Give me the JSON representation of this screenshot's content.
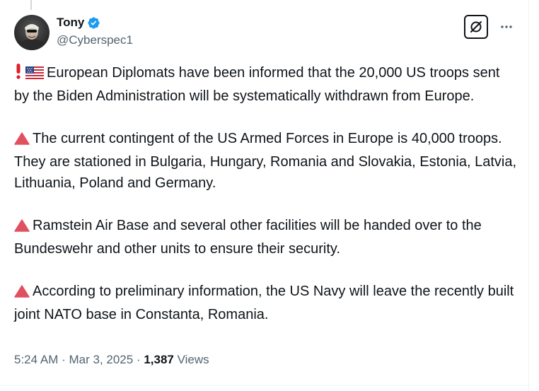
{
  "author": {
    "display_name": "Tony",
    "handle": "@Cyberspec1",
    "verified": true,
    "avatar_icon": "avatar-person-icon"
  },
  "actions": {
    "grok_icon": "grok-slash-circle-icon",
    "more_icon": "more-horizontal-icon"
  },
  "tweet": {
    "paragraphs": [
      {
        "prefix_icon": "exclamation-flag-us-icon",
        "text": "European Diplomats have been informed that the 20,000 US troops sent by the Biden Administration will be systematically withdrawn from Europe."
      },
      {
        "prefix_icon": "red-triangle-icon",
        "text": "The current contingent of the US Armed Forces in Europe is 40,000 troops. They are stationed in Bulgaria, Hungary, Romania and Slovakia, Estonia, Latvia, Lithuania, Poland and Germany."
      },
      {
        "prefix_icon": "red-triangle-icon",
        "text": "Ramstein Air Base and several other facilities will be handed over to the Bundeswehr and other units to ensure their security."
      },
      {
        "prefix_icon": "red-triangle-icon",
        "text": "According to preliminary information, the US Navy will leave the recently built joint NATO base in Constanta, Romania."
      }
    ]
  },
  "meta": {
    "time": "5:24 AM",
    "separator": " · ",
    "date": "Mar 3, 2025",
    "views_count": "1,387",
    "views_label": "Views"
  },
  "colors": {
    "text_primary": "#0f1419",
    "text_secondary": "#536471",
    "verified_blue": "#1d9bf0",
    "triangle_red": "#e0505f",
    "exclamation_red": "#e01f28",
    "divider": "#eff3f4"
  }
}
